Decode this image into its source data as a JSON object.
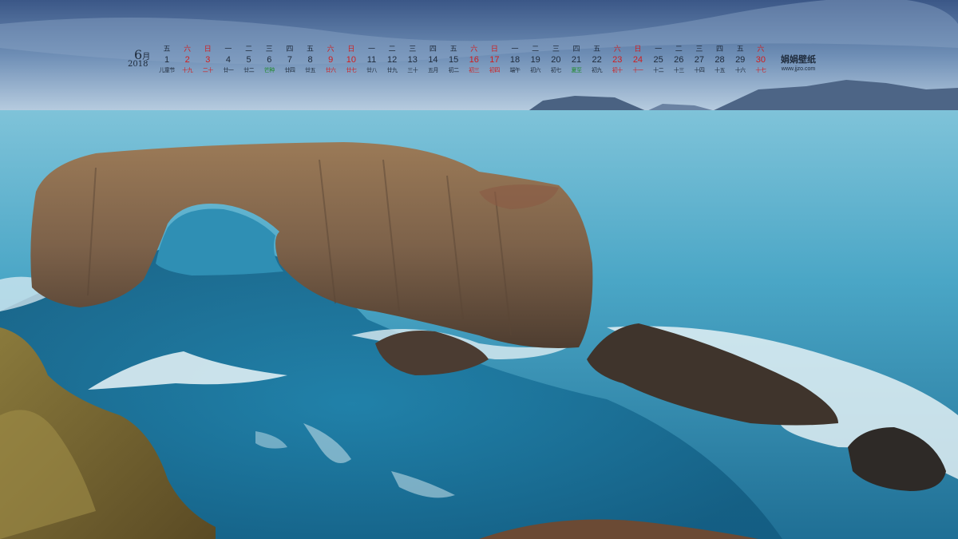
{
  "calendar": {
    "month": "6",
    "month_suffix": "月",
    "year": "2018",
    "days": [
      {
        "weekday": "五",
        "day": "1",
        "lunar": "儿童节",
        "weekend": false,
        "lunar_color": "normal"
      },
      {
        "weekday": "六",
        "day": "2",
        "lunar": "十九",
        "weekend": true,
        "lunar_color": "red"
      },
      {
        "weekday": "日",
        "day": "3",
        "lunar": "二十",
        "weekend": true,
        "lunar_color": "red"
      },
      {
        "weekday": "一",
        "day": "4",
        "lunar": "廿一",
        "weekend": false,
        "lunar_color": "normal"
      },
      {
        "weekday": "二",
        "day": "5",
        "lunar": "廿二",
        "weekend": false,
        "lunar_color": "normal"
      },
      {
        "weekday": "三",
        "day": "6",
        "lunar": "芒种",
        "weekend": false,
        "lunar_color": "green"
      },
      {
        "weekday": "四",
        "day": "7",
        "lunar": "廿四",
        "weekend": false,
        "lunar_color": "normal"
      },
      {
        "weekday": "五",
        "day": "8",
        "lunar": "廿五",
        "weekend": false,
        "lunar_color": "normal"
      },
      {
        "weekday": "六",
        "day": "9",
        "lunar": "廿六",
        "weekend": true,
        "lunar_color": "red"
      },
      {
        "weekday": "日",
        "day": "10",
        "lunar": "廿七",
        "weekend": true,
        "lunar_color": "red"
      },
      {
        "weekday": "一",
        "day": "11",
        "lunar": "廿八",
        "weekend": false,
        "lunar_color": "normal"
      },
      {
        "weekday": "二",
        "day": "12",
        "lunar": "廿九",
        "weekend": false,
        "lunar_color": "normal"
      },
      {
        "weekday": "三",
        "day": "13",
        "lunar": "三十",
        "weekend": false,
        "lunar_color": "normal"
      },
      {
        "weekday": "四",
        "day": "14",
        "lunar": "五月",
        "weekend": false,
        "lunar_color": "normal"
      },
      {
        "weekday": "五",
        "day": "15",
        "lunar": "初二",
        "weekend": false,
        "lunar_color": "normal"
      },
      {
        "weekday": "六",
        "day": "16",
        "lunar": "初三",
        "weekend": true,
        "lunar_color": "red"
      },
      {
        "weekday": "日",
        "day": "17",
        "lunar": "初四",
        "weekend": true,
        "lunar_color": "red"
      },
      {
        "weekday": "一",
        "day": "18",
        "lunar": "端午",
        "weekend": false,
        "lunar_color": "normal"
      },
      {
        "weekday": "二",
        "day": "19",
        "lunar": "初六",
        "weekend": false,
        "lunar_color": "normal"
      },
      {
        "weekday": "三",
        "day": "20",
        "lunar": "初七",
        "weekend": false,
        "lunar_color": "normal"
      },
      {
        "weekday": "四",
        "day": "21",
        "lunar": "夏至",
        "weekend": false,
        "lunar_color": "green"
      },
      {
        "weekday": "五",
        "day": "22",
        "lunar": "初九",
        "weekend": false,
        "lunar_color": "normal"
      },
      {
        "weekday": "六",
        "day": "23",
        "lunar": "初十",
        "weekend": true,
        "lunar_color": "red"
      },
      {
        "weekday": "日",
        "day": "24",
        "lunar": "十一",
        "weekend": true,
        "lunar_color": "red"
      },
      {
        "weekday": "一",
        "day": "25",
        "lunar": "十二",
        "weekend": false,
        "lunar_color": "normal"
      },
      {
        "weekday": "二",
        "day": "26",
        "lunar": "十三",
        "weekend": false,
        "lunar_color": "normal"
      },
      {
        "weekday": "三",
        "day": "27",
        "lunar": "十四",
        "weekend": false,
        "lunar_color": "normal"
      },
      {
        "weekday": "四",
        "day": "28",
        "lunar": "十五",
        "weekend": false,
        "lunar_color": "normal"
      },
      {
        "weekday": "五",
        "day": "29",
        "lunar": "十六",
        "weekend": false,
        "lunar_color": "normal"
      },
      {
        "weekday": "六",
        "day": "30",
        "lunar": "十七",
        "weekend": true,
        "lunar_color": "red"
      }
    ]
  },
  "brand": {
    "name": "娟娟壁纸",
    "url": "www.jjzo.com"
  },
  "colors": {
    "weekend_red": "#d01e1e",
    "solar_term_green": "#1f8a2a",
    "text_dark": "#1e2a3a",
    "sky_top": "#3b5787",
    "sea": "#3a96b8",
    "rock": "#8a6a4c"
  }
}
